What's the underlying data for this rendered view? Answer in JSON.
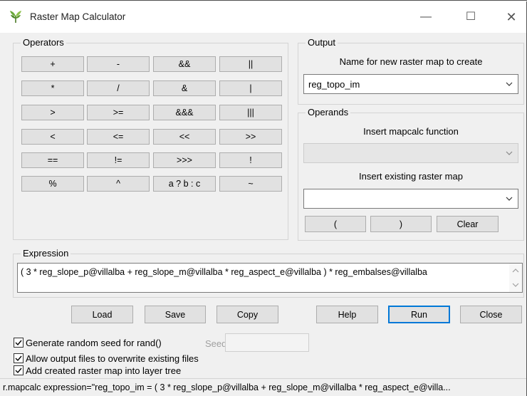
{
  "window": {
    "title": "Raster Map Calculator",
    "controls": {
      "minimize": "—",
      "maximize": "☐",
      "close": "✕"
    }
  },
  "operators": {
    "title": "Operators",
    "buttons": [
      "+",
      "-",
      "&&",
      "||",
      "*",
      "/",
      "&",
      "|",
      ">",
      ">=",
      "&&&",
      "|||",
      "<",
      "<=",
      "<<",
      ">>",
      "==",
      "!=",
      ">>>",
      "!",
      "%",
      "^",
      "a ? b : c",
      "~"
    ]
  },
  "output": {
    "title": "Output",
    "name_label": "Name for new raster map to create",
    "name_value": "reg_topo_im"
  },
  "operands": {
    "title": "Operands",
    "function_label": "Insert mapcalc function",
    "function_value": "",
    "raster_label": "Insert existing raster map",
    "raster_value": "",
    "open_paren": "(",
    "close_paren": ")",
    "clear": "Clear"
  },
  "expression": {
    "title": "Expression",
    "value": "( 3 * reg_slope_p@villalba + reg_slope_m@villalba * reg_aspect_e@villalba ) * reg_embalses@villalba"
  },
  "actions": {
    "load": "Load",
    "save": "Save",
    "copy": "Copy",
    "help": "Help",
    "run": "Run",
    "close": "Close"
  },
  "options": {
    "random_seed": {
      "label": "Generate random seed for rand()",
      "checked": true
    },
    "seed_label": "Seed:",
    "seed_value": "",
    "overwrite": {
      "label": "Allow output files to overwrite existing files",
      "checked": true
    },
    "add_layer": {
      "label": "Add created raster map into layer tree",
      "checked": true
    }
  },
  "status": {
    "text": "r.mapcalc expression=\"reg_topo_im = ( 3 * reg_slope_p@villalba + reg_slope_m@villalba * reg_aspect_e@villa..."
  },
  "colors": {
    "accent": "#0078d7",
    "button_face": "#e1e1e1",
    "window_bg": "#f0f0f0"
  }
}
